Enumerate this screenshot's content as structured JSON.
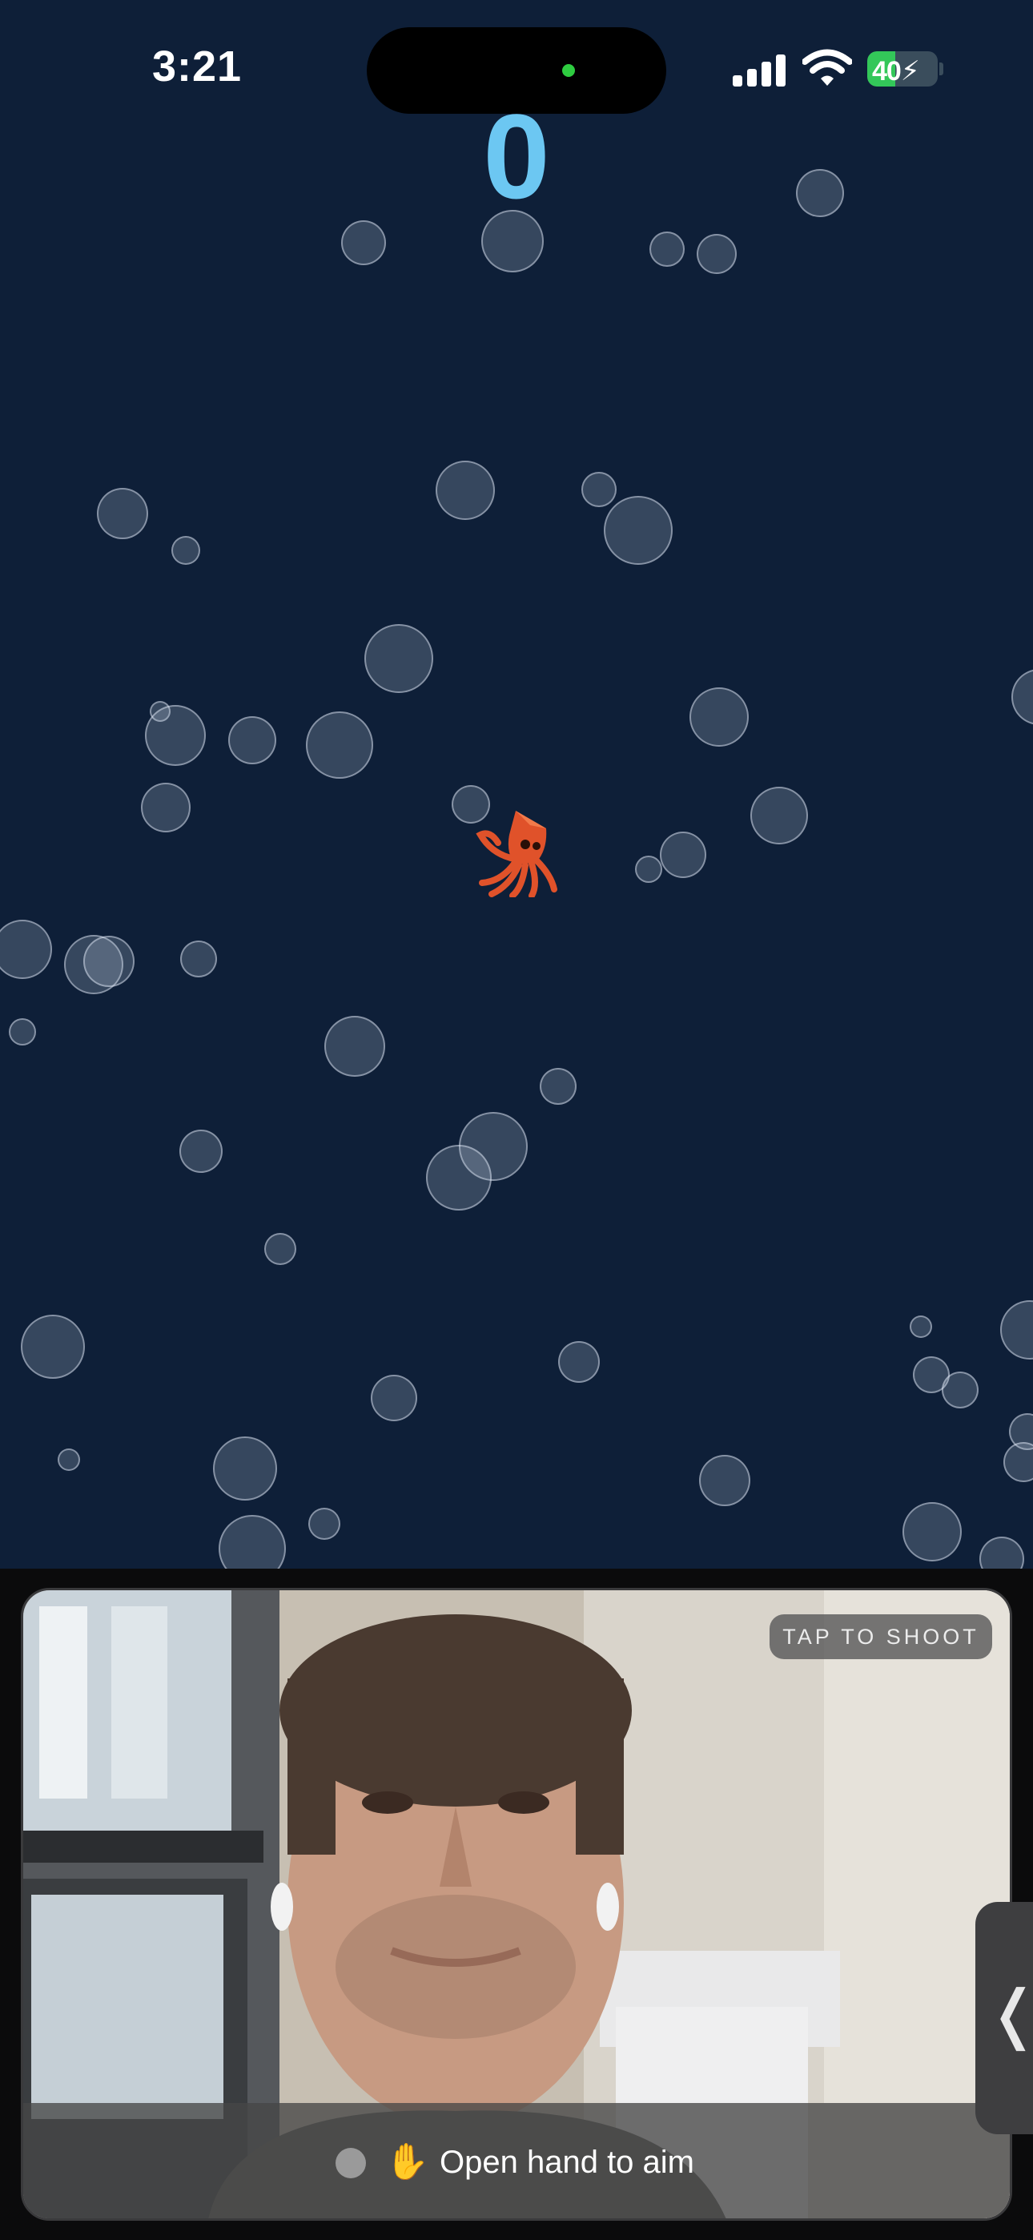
{
  "status_bar": {
    "time": "3:21",
    "battery_level": "40",
    "battery_charging": true,
    "signal_bars": 4,
    "wifi": true,
    "camera_indicator_color": "#2ecc40"
  },
  "game": {
    "score": "0",
    "player": "squid-icon",
    "background_color": "#0e1f38"
  },
  "camera": {
    "tap_label": "TAP TO SHOOT",
    "hint_icon": "✋",
    "hint_text": "Open hand to aim",
    "expand_icon": "chevron-left-icon"
  }
}
